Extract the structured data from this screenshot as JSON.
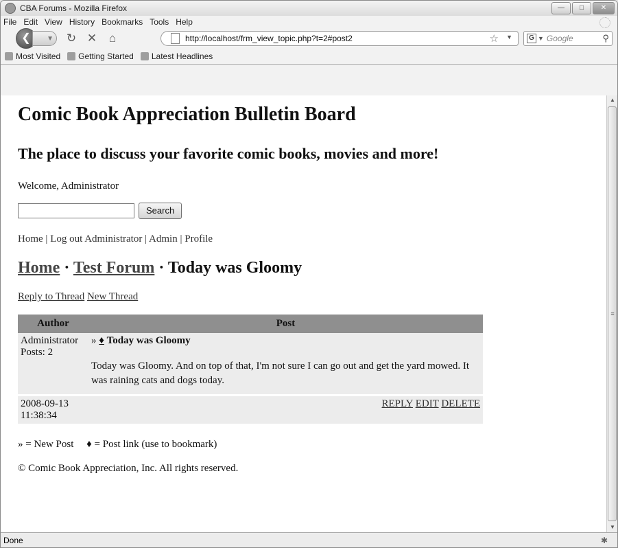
{
  "window": {
    "title": "CBA Forums - Mozilla Firefox"
  },
  "menu": [
    "File",
    "Edit",
    "View",
    "History",
    "Bookmarks",
    "Tools",
    "Help"
  ],
  "toolbar": {
    "url": "http://localhost/frm_view_topic.php?t=2#post2",
    "search_placeholder": "Google"
  },
  "bookmarks": [
    "Most Visited",
    "Getting Started",
    "Latest Headlines"
  ],
  "page": {
    "title": "Comic Book Appreciation Bulletin Board",
    "subtitle": "The place to discuss your favorite comic books, movies and more!",
    "welcome": "Welcome, Administrator",
    "search_button": "Search",
    "nav": {
      "home": "Home",
      "logout": "Log out Administrator",
      "admin": "Admin",
      "profile": "Profile"
    },
    "breadcrumb": {
      "home": "Home",
      "forum": "Test Forum",
      "topic": "Today was Gloomy"
    },
    "actions": {
      "reply": "Reply to Thread",
      "new": "New Thread"
    },
    "table": {
      "headers": {
        "author": "Author",
        "post": "Post"
      },
      "post": {
        "author": "Administrator",
        "posts_count": "Posts: 2",
        "marker": "»",
        "link_glyph": "♦",
        "title": "Today was Gloomy",
        "body": "Today was Gloomy. And on top of that, I'm not sure I can go out and get the yard mowed. It was raining cats and dogs today.",
        "date": "2008-09-13",
        "time": "11:38:34",
        "reply": "REPLY",
        "edit": "EDIT",
        "delete": "DELETE"
      }
    },
    "legend": {
      "new_post": "» = New Post",
      "post_link": "♦ = Post link (use to bookmark)"
    },
    "copyright": "© Comic Book Appreciation, Inc. All rights reserved."
  },
  "status": "Done"
}
